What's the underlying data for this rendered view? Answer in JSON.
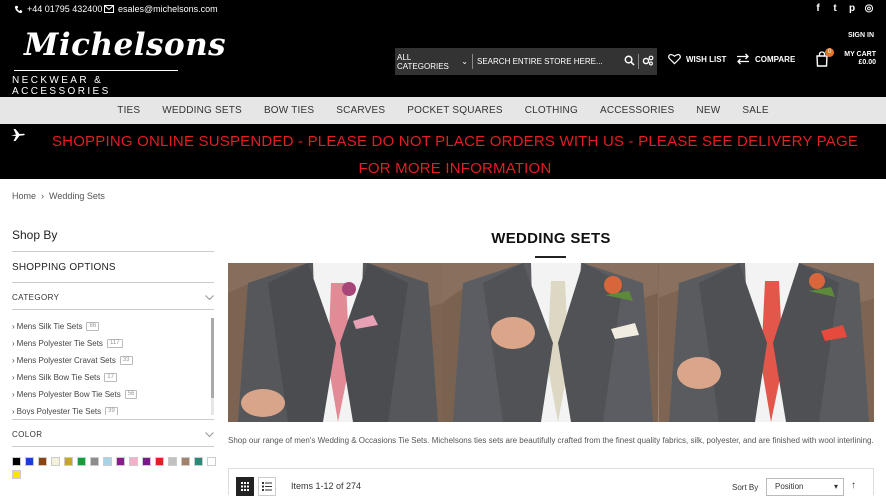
{
  "topbar": {
    "phone": "+44 01795 432400",
    "email": "esales@michelsons.com",
    "social_icons": [
      "facebook-icon",
      "twitter-icon",
      "pinterest-icon",
      "instagram-icon"
    ]
  },
  "header": {
    "logo_name": "Michelsons",
    "logo_tagline": "NECKWEAR & ACCESSORIES",
    "search_category": "ALL CATEGORIES",
    "search_placeholder": "SEARCH ENTIRE STORE HERE...",
    "wishlist": "WISH LIST",
    "compare": "COMPARE",
    "sign_in": "SIGN IN",
    "cart_label": "MY CART",
    "cart_total": "£0.00",
    "cart_count": "0"
  },
  "nav": [
    "TIES",
    "WEDDING SETS",
    "BOW TIES",
    "SCARVES",
    "POCKET SQUARES",
    "CLOTHING",
    "ACCESSORIES",
    "NEW",
    "SALE"
  ],
  "notice": "SHOPPING ONLINE SUSPENDED - PLEASE DO NOT PLACE ORDERS WITH US - PLEASE SEE DELIVERY PAGE FOR MORE INFORMATION",
  "breadcrumb": {
    "home": "Home",
    "separator": "›",
    "current": "Wedding Sets"
  },
  "sidebar": {
    "shop_by": "Shop By",
    "shopping_options": "SHOPPING OPTIONS",
    "category_title": "CATEGORY",
    "categories": [
      {
        "label": "Mens Silk Tie Sets",
        "count": "86"
      },
      {
        "label": "Mens Polyester Tie Sets",
        "count": "117"
      },
      {
        "label": "Mens Polyester Cravat Sets",
        "count": "33"
      },
      {
        "label": "Mens Silk Bow Tie Sets",
        "count": "17"
      },
      {
        "label": "Mens Polyester Bow Tie Sets",
        "count": "56"
      },
      {
        "label": "Boys Polyester Tie Sets",
        "count": "39"
      }
    ],
    "color_title": "COLOR",
    "colors": [
      "#000000",
      "#1c3fd1",
      "#8b4513",
      "#f5f0dc",
      "#c8a232",
      "#1a9a3a",
      "#8c8c8c",
      "#a8d4e8",
      "#8b1a8b",
      "#f4b0c8",
      "#7a1a8a",
      "#e31e24",
      "#c0c0c0",
      "#a0826d",
      "#2a8a7a",
      "#ffffff",
      "#f5e600"
    ]
  },
  "main": {
    "title": "WEDDING SETS",
    "description": "Shop our range of men's Wedding & Occasions Tie Sets. Michelsons ties sets are beautifully crafted from the finest quality fabrics, silk, polyester, and are finished with wool interlining.",
    "items_count": "Items 1-12 of 274",
    "sort_by_label": "Sort By",
    "sort_value": "Position"
  }
}
